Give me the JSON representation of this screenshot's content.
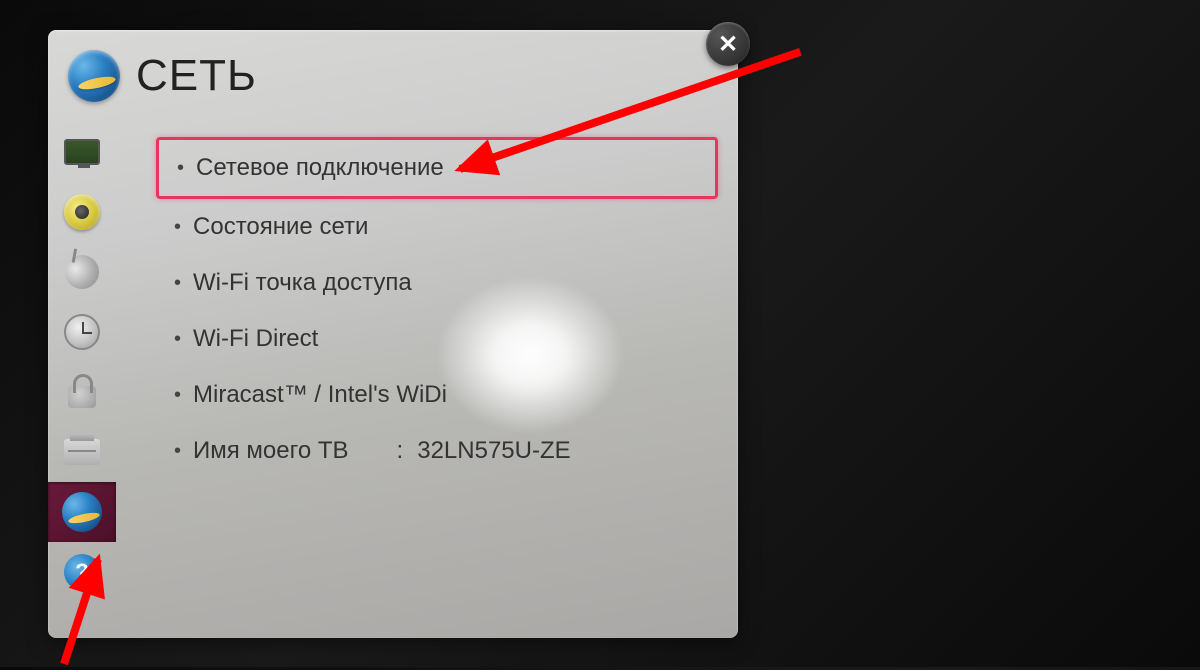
{
  "header": {
    "title": "СЕТЬ"
  },
  "sidebar": {
    "items": [
      {
        "name": "picture"
      },
      {
        "name": "sound"
      },
      {
        "name": "channel"
      },
      {
        "name": "time"
      },
      {
        "name": "lock"
      },
      {
        "name": "option"
      },
      {
        "name": "network",
        "selected": true
      },
      {
        "name": "support"
      }
    ]
  },
  "menu": {
    "items": [
      {
        "label": "Сетевое подключение",
        "highlighted": true
      },
      {
        "label": "Состояние сети"
      },
      {
        "label": "Wi-Fi точка доступа"
      },
      {
        "label": "Wi-Fi Direct"
      },
      {
        "label": "Miracast™ / Intel's WiDi"
      },
      {
        "label": "Имя моего ТВ",
        "value": "32LN575U-ZE",
        "separator": ":"
      }
    ]
  },
  "colors": {
    "highlight": "#e63560",
    "arrow": "#ff0000"
  }
}
